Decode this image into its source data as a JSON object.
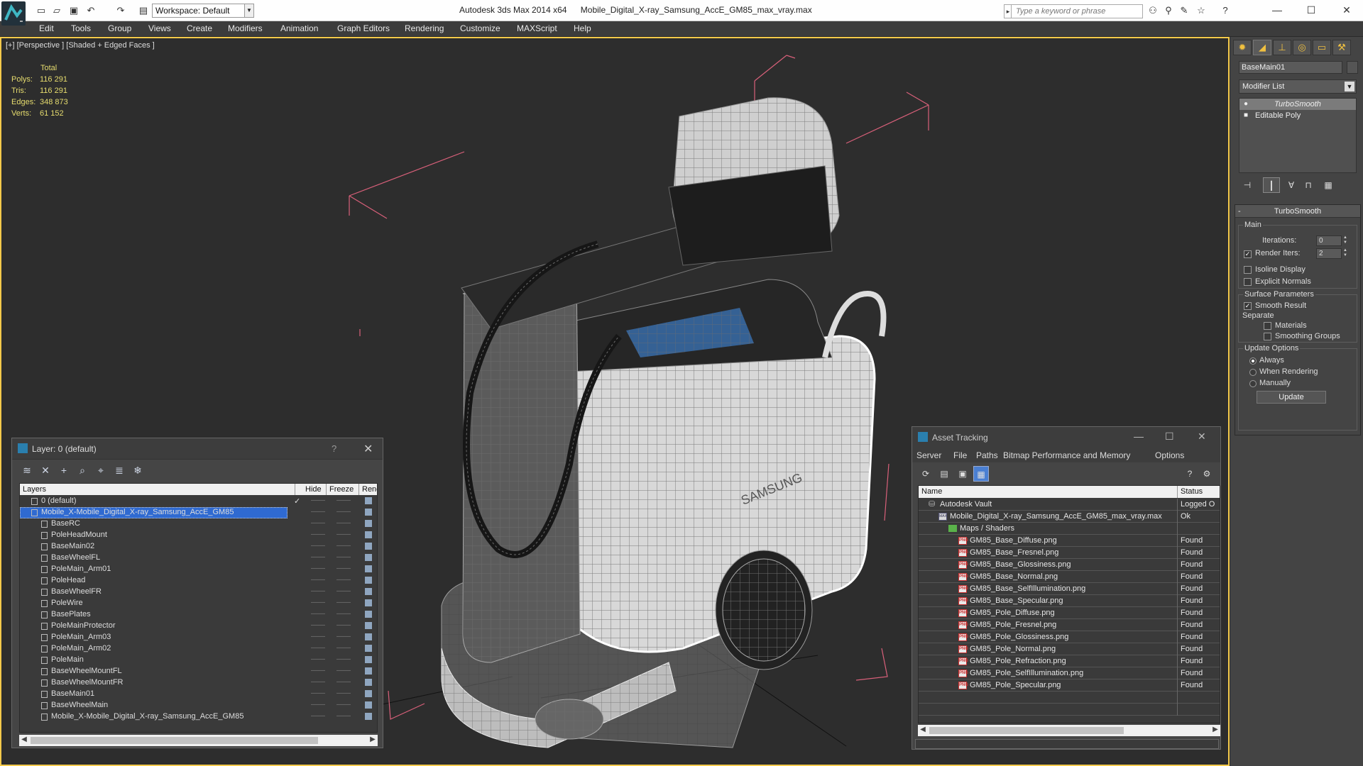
{
  "titlebar": {
    "workspace": "Workspace: Default",
    "app_name": "Autodesk 3ds Max  2014 x64",
    "file_name": "Mobile_Digital_X-ray_Samsung_AccE_GM85_max_vray.max",
    "search_placeholder": "Type a keyword or phrase"
  },
  "menu": [
    "Edit",
    "Tools",
    "Group",
    "Views",
    "Create",
    "Modifiers",
    "Animation",
    "Graph Editors",
    "Rendering",
    "Customize",
    "MAXScript",
    "Help"
  ],
  "viewport": {
    "label": "[+] [Perspective ] [Shaded + Edged Faces ]",
    "stats": {
      "header": "Total",
      "rows": [
        {
          "label": "Polys:",
          "value": "116 291"
        },
        {
          "label": "Tris:",
          "value": "116 291"
        },
        {
          "label": "Edges:",
          "value": "348 873"
        },
        {
          "label": "Verts:",
          "value": "61 152"
        }
      ]
    },
    "brand_text": "SAMSUNG"
  },
  "command_panel": {
    "object_name": "BaseMain01",
    "modifier_list": "Modifier List",
    "stack": [
      "TurboSmooth",
      "Editable Poly"
    ],
    "rollout_title": "TurboSmooth",
    "main_label": "Main",
    "iterations_label": "Iterations:",
    "iterations_value": "0",
    "render_iters_label": "Render Iters:",
    "render_iters_value": "2",
    "isoline_label": "Isoline Display",
    "explicit_normals_label": "Explicit Normals",
    "surface_params_label": "Surface Parameters",
    "smooth_result_label": "Smooth Result",
    "separate_label": "Separate",
    "materials_label": "Materials",
    "smoothing_groups_label": "Smoothing Groups",
    "update_options_label": "Update Options",
    "always_label": "Always",
    "when_rendering_label": "When Rendering",
    "manually_label": "Manually",
    "update_button": "Update"
  },
  "layer_window": {
    "title": "Layer: 0 (default)",
    "columns": [
      "Layers",
      "Hide",
      "Freeze",
      "Renc"
    ],
    "layers": [
      {
        "name": "0 (default)",
        "level": 0,
        "kind": "layer"
      },
      {
        "name": "Mobile_X-Mobile_Digital_X-ray_Samsung_AccE_GM85",
        "level": 0,
        "kind": "layer",
        "selected": true
      },
      {
        "name": "BaseRC",
        "level": 1,
        "kind": "object"
      },
      {
        "name": "PoleHeadMount",
        "level": 1,
        "kind": "object"
      },
      {
        "name": "BaseMain02",
        "level": 1,
        "kind": "object"
      },
      {
        "name": "BaseWheelFL",
        "level": 1,
        "kind": "object"
      },
      {
        "name": "PoleMain_Arm01",
        "level": 1,
        "kind": "object"
      },
      {
        "name": "PoleHead",
        "level": 1,
        "kind": "object"
      },
      {
        "name": "BaseWheelFR",
        "level": 1,
        "kind": "object"
      },
      {
        "name": "PoleWire",
        "level": 1,
        "kind": "object"
      },
      {
        "name": "BasePlates",
        "level": 1,
        "kind": "object"
      },
      {
        "name": "PoleMainProtector",
        "level": 1,
        "kind": "object"
      },
      {
        "name": "PoleMain_Arm03",
        "level": 1,
        "kind": "object"
      },
      {
        "name": "PoleMain_Arm02",
        "level": 1,
        "kind": "object"
      },
      {
        "name": "PoleMain",
        "level": 1,
        "kind": "object"
      },
      {
        "name": "BaseWheelMountFL",
        "level": 1,
        "kind": "object"
      },
      {
        "name": "BaseWheelMountFR",
        "level": 1,
        "kind": "object"
      },
      {
        "name": "BaseMain01",
        "level": 1,
        "kind": "object"
      },
      {
        "name": "BaseWheelMain",
        "level": 1,
        "kind": "object"
      },
      {
        "name": "Mobile_X-Mobile_Digital_X-ray_Samsung_AccE_GM85",
        "level": 1,
        "kind": "object"
      }
    ]
  },
  "asset_window": {
    "title": "Asset Tracking",
    "menu": [
      "Server",
      "File",
      "Paths",
      "Bitmap Performance and Memory",
      "Options"
    ],
    "columns": [
      "Name",
      "Status"
    ],
    "rows": [
      {
        "name": "Autodesk Vault",
        "status": "Logged O",
        "kind": "vault",
        "level": 0
      },
      {
        "name": "Mobile_Digital_X-ray_Samsung_AccE_GM85_max_vray.max",
        "status": "Ok",
        "kind": "max",
        "level": 1
      },
      {
        "name": "Maps / Shaders",
        "status": "",
        "kind": "folder",
        "level": 2
      },
      {
        "name": "GM85_Base_Diffuse.png",
        "status": "Found",
        "kind": "png",
        "level": 3
      },
      {
        "name": "GM85_Base_Fresnel.png",
        "status": "Found",
        "kind": "png",
        "level": 3
      },
      {
        "name": "GM85_Base_Glossiness.png",
        "status": "Found",
        "kind": "png",
        "level": 3
      },
      {
        "name": "GM85_Base_Normal.png",
        "status": "Found",
        "kind": "png",
        "level": 3
      },
      {
        "name": "GM85_Base_SelfIllumination.png",
        "status": "Found",
        "kind": "png",
        "level": 3
      },
      {
        "name": "GM85_Base_Specular.png",
        "status": "Found",
        "kind": "png",
        "level": 3
      },
      {
        "name": "GM85_Pole_Diffuse.png",
        "status": "Found",
        "kind": "png",
        "level": 3
      },
      {
        "name": "GM85_Pole_Fresnel.png",
        "status": "Found",
        "kind": "png",
        "level": 3
      },
      {
        "name": "GM85_Pole_Glossiness.png",
        "status": "Found",
        "kind": "png",
        "level": 3
      },
      {
        "name": "GM85_Pole_Normal.png",
        "status": "Found",
        "kind": "png",
        "level": 3
      },
      {
        "name": "GM85_Pole_Refraction.png",
        "status": "Found",
        "kind": "png",
        "level": 3
      },
      {
        "name": "GM85_Pole_SelfIllumination.png",
        "status": "Found",
        "kind": "png",
        "level": 3
      },
      {
        "name": "GM85_Pole_Specular.png",
        "status": "Found",
        "kind": "png",
        "level": 3
      }
    ]
  },
  "colors": {
    "viewport_border": "#f3c94a",
    "stats_text": "#e6dc6e",
    "selection": "#2f6ad1",
    "bbox_lines": "#d9607a"
  }
}
